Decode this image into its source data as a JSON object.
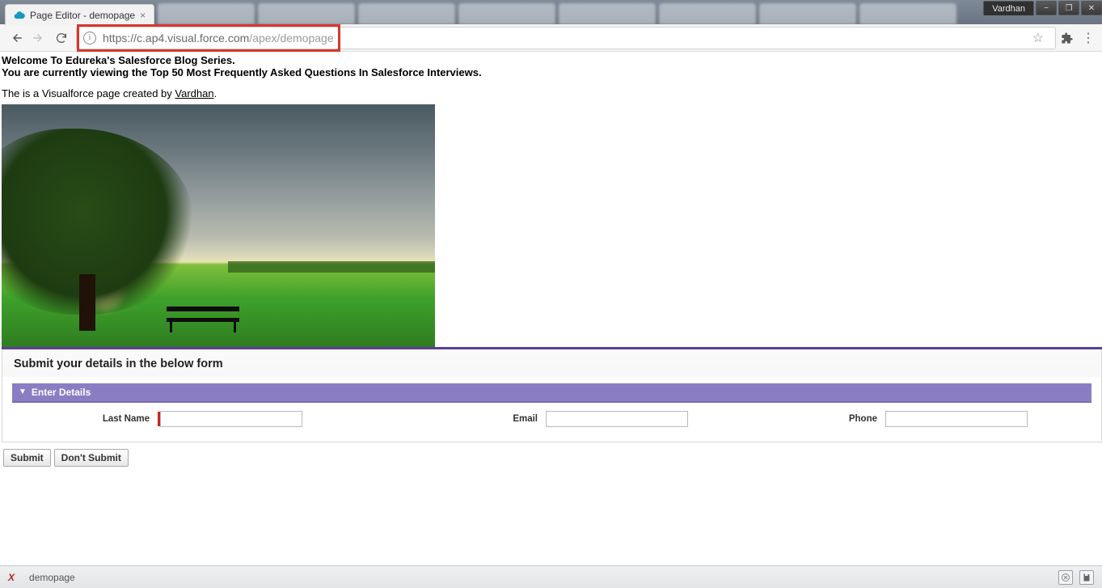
{
  "os": {
    "user_label": "Vardhan",
    "minimize": "−",
    "maximize": "❐",
    "close": "✕"
  },
  "browser": {
    "active_tab": {
      "title": "Page Editor - demopage"
    },
    "url_display_host": "https://c.ap4.visual.force.com",
    "url_display_path": "/apex/demopage"
  },
  "page": {
    "heading_line1": "Welcome To Edureka's Salesforce Blog Series.",
    "heading_line2": "You are currently viewing the Top 50 Most Frequently Asked Questions In Salesforce Interviews.",
    "subline_prefix": "The is a Visualforce page created by ",
    "subline_link": "Vardhan",
    "subline_suffix": "."
  },
  "form": {
    "block_title": "Submit your details in the below form",
    "section_title": "Enter Details",
    "fields": {
      "last_name": {
        "label": "Last Name",
        "value": "",
        "required": true
      },
      "email": {
        "label": "Email",
        "value": "",
        "required": false
      },
      "phone": {
        "label": "Phone",
        "value": "",
        "required": false
      }
    },
    "buttons": {
      "submit": "Submit",
      "cancel": "Don't Submit"
    }
  },
  "dev_footer": {
    "page_name": "demopage"
  }
}
